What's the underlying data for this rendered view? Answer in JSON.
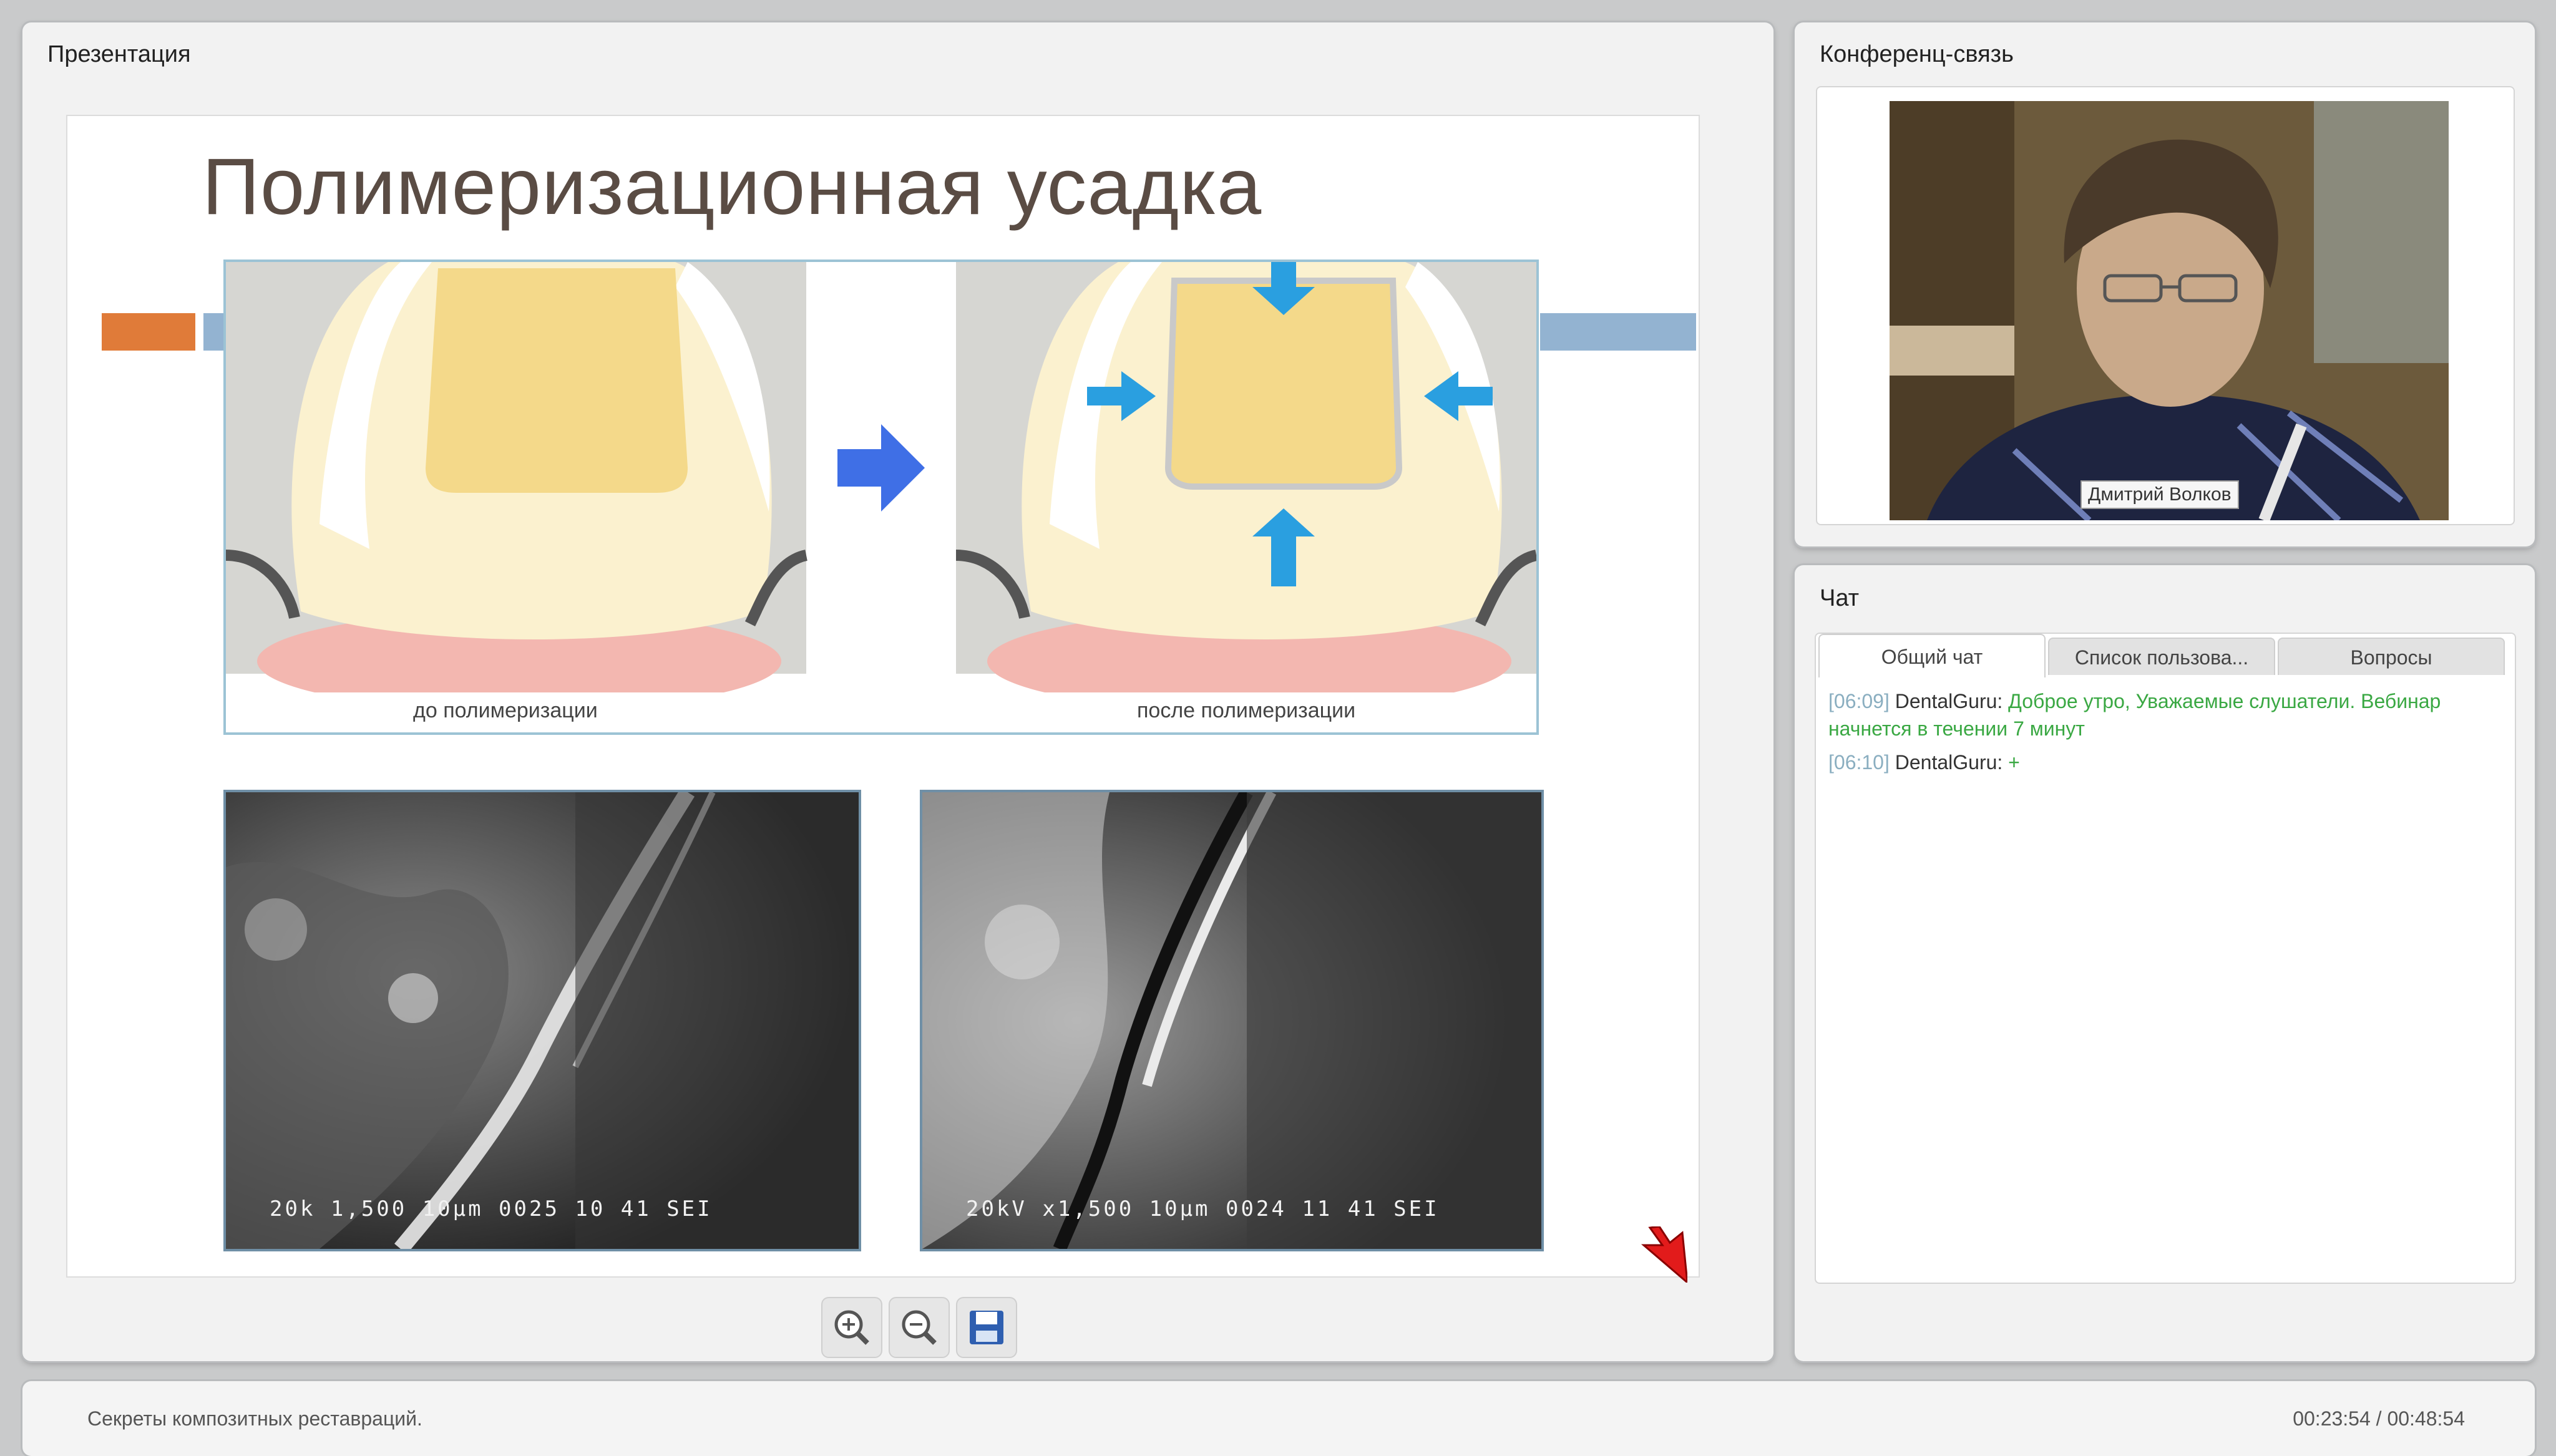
{
  "presentation": {
    "panel_title": "Презентация",
    "slide": {
      "title": "Полимеризационная усадка",
      "caption_before": "до полимеризации",
      "caption_after": "после полимеризации",
      "sem_left_label": "20k  1,500  10μm  0025  10 41 SEI",
      "sem_right_label": "20kV  x1,500  10μm  0024  11 41 SEI"
    },
    "toolbar": {
      "zoom_in": "zoom-in-icon",
      "zoom_out": "zoom-out-icon",
      "save": "save-icon"
    }
  },
  "conference": {
    "panel_title": "Конференц-связь",
    "presenter_name": "Дмитрий Волков"
  },
  "chat": {
    "panel_title": "Чат",
    "tabs": [
      {
        "label": "Общий чат",
        "active": true
      },
      {
        "label": "Список пользова...",
        "active": false
      },
      {
        "label": "Вопросы",
        "active": false
      }
    ],
    "messages": [
      {
        "time": "[06:09]",
        "author": "DentalGuru:",
        "text": "Доброе утро, Уважаемые слушатели. Вебинар начнется в течении 7 минут"
      },
      {
        "time": "[06:10]",
        "author": "DentalGuru:",
        "text": "+"
      }
    ]
  },
  "status": {
    "course_title": "Секреты композитных реставраций.",
    "time": "00:23:54 / 00:48:54"
  },
  "colors": {
    "accent_blue": "#3f6fe6",
    "arrow_blue": "#2a9fe0",
    "deco_orange": "#e07b39",
    "deco_blue": "#93b3d1",
    "chat_text_green": "#3aa843"
  }
}
